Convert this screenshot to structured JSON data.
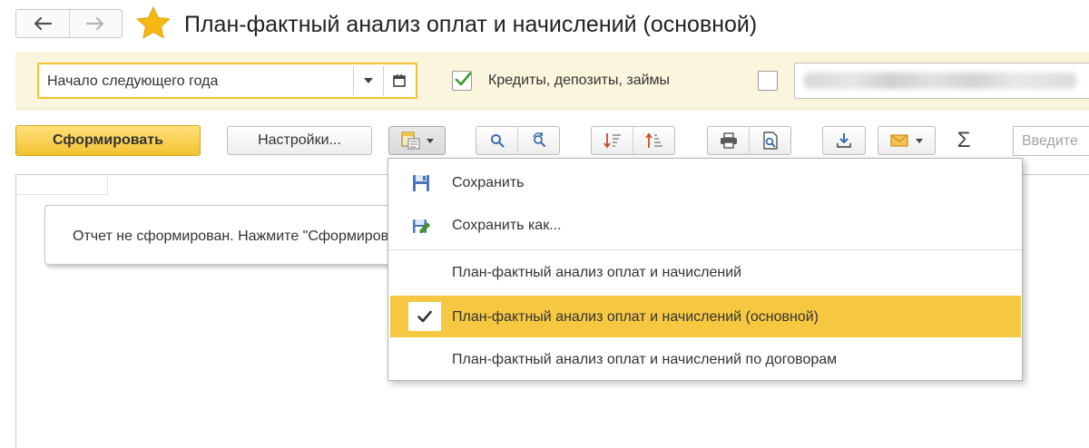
{
  "header": {
    "back_icon": "arrow-left-icon",
    "forward_icon": "arrow-right-icon",
    "favorite_icon": "star-icon",
    "title": "План-фактный анализ оплат и начислений (основной)"
  },
  "filters": {
    "period_value": "Начало следующего года",
    "credits_label": "Кредиты, депозиты, займы",
    "credits_checked": true,
    "second_checked": false
  },
  "toolbar": {
    "generate_label": "Сформировать",
    "settings_label": "Настройки...",
    "sum_placeholder": "Введите"
  },
  "report": {
    "notice_text": "Отчет не сформирован. Нажмите \"Сформировать\" для получения отчета."
  },
  "variants_menu": {
    "save_label": "Сохранить",
    "save_as_label": "Сохранить как...",
    "items": [
      {
        "label": "План-фактный анализ оплат и начислений",
        "selected": false
      },
      {
        "label": "План-фактный анализ оплат и начислений (основной)",
        "selected": true
      },
      {
        "label": "План-фактный анализ оплат и начислений по договорам",
        "selected": false
      }
    ]
  },
  "colors": {
    "accent_yellow": "#f2c232",
    "selected_row": "#f6c842",
    "filter_panel_bg": "#fbf5dd",
    "check_green": "#3a9a2a"
  }
}
